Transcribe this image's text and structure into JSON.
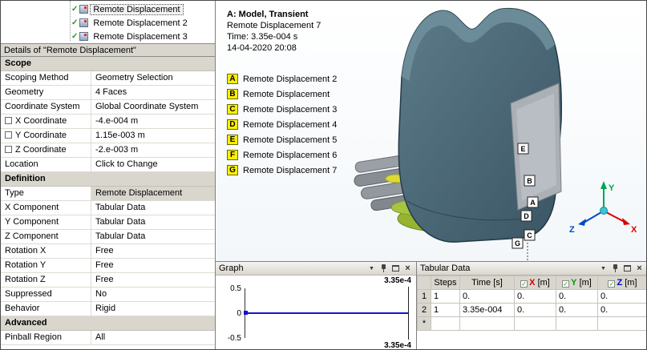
{
  "tree": {
    "items": [
      {
        "label": "Remote Displacement",
        "selected": true
      },
      {
        "label": "Remote Displacement 2",
        "selected": false
      },
      {
        "label": "Remote Displacement 3",
        "selected": false
      }
    ]
  },
  "details": {
    "caption": "Details of \"Remote Displacement\"",
    "rows": [
      {
        "group": "Scope"
      },
      {
        "label": "Scoping Method",
        "value": "Geometry Selection"
      },
      {
        "label": "Geometry",
        "value": "4 Faces"
      },
      {
        "label": "Coordinate System",
        "value": "Global Coordinate System"
      },
      {
        "label": "X Coordinate",
        "value": "-4.e-004 m",
        "checkbox": true
      },
      {
        "label": "Y Coordinate",
        "value": "1.15e-003 m",
        "checkbox": true
      },
      {
        "label": "Z Coordinate",
        "value": "-2.e-003 m",
        "checkbox": true
      },
      {
        "label": "Location",
        "value": "Click to Change"
      },
      {
        "group": "Definition"
      },
      {
        "label": "Type",
        "value": "Remote Displacement",
        "highlight": true
      },
      {
        "label": "X Component",
        "value": "Tabular Data"
      },
      {
        "label": "Y Component",
        "value": "Tabular Data"
      },
      {
        "label": "Z Component",
        "value": "Tabular Data"
      },
      {
        "label": "Rotation X",
        "value": "Free"
      },
      {
        "label": "Rotation Y",
        "value": "Free"
      },
      {
        "label": "Rotation Z",
        "value": "Free"
      },
      {
        "label": "Suppressed",
        "value": "No"
      },
      {
        "label": "Behavior",
        "value": "Rigid"
      },
      {
        "group": "Advanced"
      },
      {
        "label": "Pinball Region",
        "value": "All"
      }
    ]
  },
  "viewport": {
    "title": "A: Model, Transient",
    "subtitle": "Remote Displacement 7",
    "time_line": "Time: 3.35e-004 s",
    "datetime_line": "14-04-2020 20:08",
    "legend": [
      {
        "key": "A",
        "label": "Remote Displacement 2"
      },
      {
        "key": "B",
        "label": "Remote Displacement"
      },
      {
        "key": "C",
        "label": "Remote Displacement 3"
      },
      {
        "key": "D",
        "label": "Remote Displacement 4"
      },
      {
        "key": "E",
        "label": "Remote Displacement 5"
      },
      {
        "key": "F",
        "label": "Remote Displacement 6"
      },
      {
        "key": "G",
        "label": "Remote Displacement 7"
      }
    ],
    "model_labels": [
      "E",
      "B",
      "A",
      "D",
      "C",
      "G"
    ],
    "triad": {
      "x": "X",
      "y": "Y",
      "z": "Z"
    },
    "triad_colors": {
      "x": "#dd0000",
      "y": "#00a650",
      "z": "#0048cc"
    }
  },
  "graph": {
    "title": "Graph",
    "y_ticks": [
      "0.5",
      "0",
      "-0.5"
    ],
    "end_time_top": "3.35e-4",
    "end_time_bottom": "3.35e-4",
    "series_value": 0,
    "line_color": "#1414cc"
  },
  "tabular": {
    "title": "Tabular Data",
    "columns": {
      "steps": "Steps",
      "time": "Time [s]",
      "x": {
        "letter": "X",
        "unit": "[m]",
        "color": "#cc0000"
      },
      "y": {
        "letter": "Y",
        "unit": "[m]",
        "color": "#00a000"
      },
      "z": {
        "letter": "Z",
        "unit": "[m]",
        "color": "#0000cc"
      }
    },
    "rows": [
      [
        "1",
        "1",
        "0.",
        "0.",
        "0.",
        "0."
      ],
      [
        "2",
        "1",
        "3.35e-004",
        "0.",
        "0.",
        "0."
      ],
      [
        "*",
        "",
        "",
        "",
        "",
        ""
      ]
    ]
  },
  "icons": {
    "caret": "▼",
    "close": "×",
    "check": "✓"
  }
}
